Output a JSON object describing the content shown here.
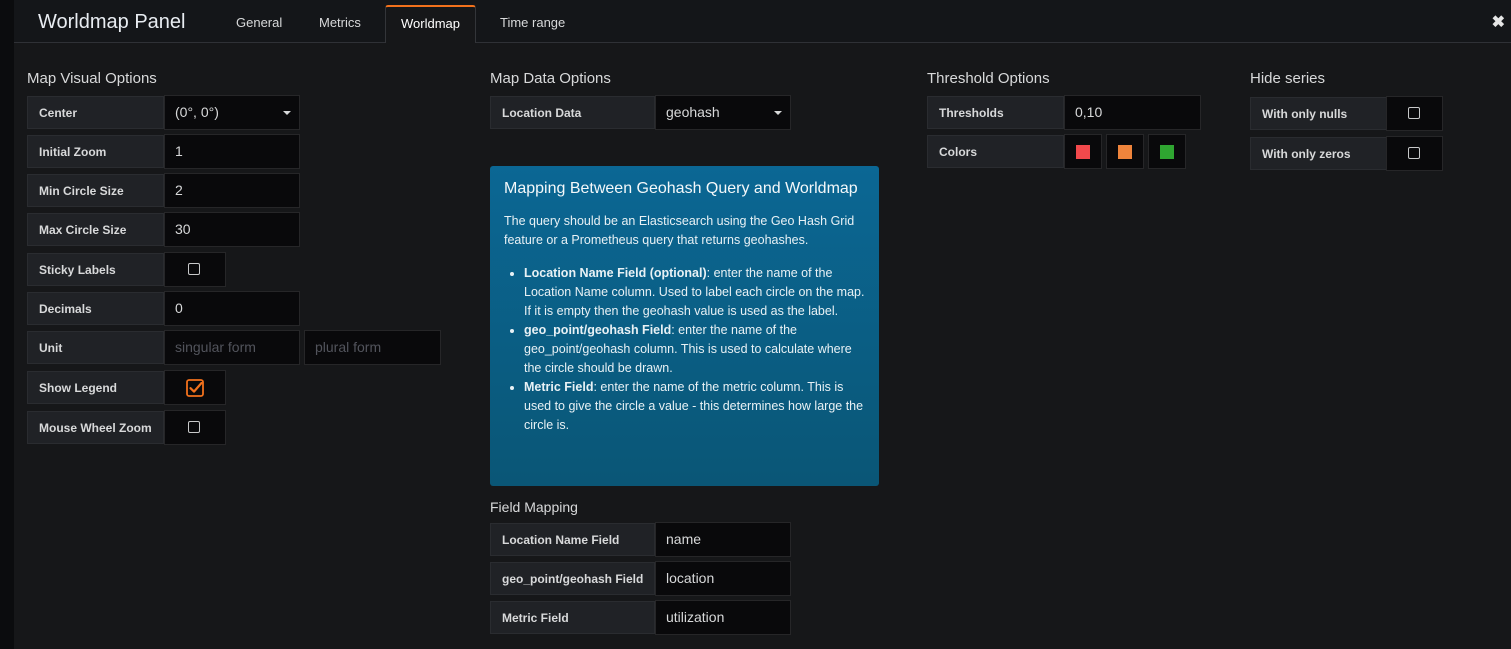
{
  "header": {
    "title": "Worldmap Panel",
    "tabs": [
      {
        "label": "General"
      },
      {
        "label": "Metrics"
      },
      {
        "label": "Worldmap"
      },
      {
        "label": "Time range"
      }
    ],
    "active_tab": "Worldmap",
    "close_symbol": "✖"
  },
  "map_visual": {
    "title": "Map Visual Options",
    "center": {
      "label": "Center",
      "value": "(0°, 0°)"
    },
    "initial_zoom": {
      "label": "Initial Zoom",
      "value": "1"
    },
    "min_circle": {
      "label": "Min Circle Size",
      "value": "2"
    },
    "max_circle": {
      "label": "Max Circle Size",
      "value": "30"
    },
    "sticky_labels": {
      "label": "Sticky Labels",
      "checked": false
    },
    "decimals": {
      "label": "Decimals",
      "value": "0"
    },
    "unit": {
      "label": "Unit",
      "singular_placeholder": "singular form",
      "plural_placeholder": "plural form"
    },
    "show_legend": {
      "label": "Show Legend",
      "checked": true
    },
    "mouse_wheel_zoom": {
      "label": "Mouse Wheel Zoom",
      "checked": false
    }
  },
  "map_data": {
    "title": "Map Data Options",
    "location_data": {
      "label": "Location Data",
      "value": "geohash"
    }
  },
  "info": {
    "title": "Mapping Between Geohash Query and Worldmap",
    "intro": "The query should be an Elasticsearch using the Geo Hash Grid feature or a Prometheus query that returns geohashes.",
    "items": [
      {
        "term": "Location Name Field (optional)",
        "text": ": enter the name of the Location Name column. Used to label each circle on the map. If it is empty then the geohash value is used as the label."
      },
      {
        "term": "geo_point/geohash Field",
        "text": ": enter the name of the geo_point/geohash column. This is used to calculate where the circle should be drawn."
      },
      {
        "term": "Metric Field",
        "text": ": enter the name of the metric column. This is used to give the circle a value - this determines how large the circle is."
      }
    ]
  },
  "field_mapping": {
    "title": "Field Mapping",
    "location_name": {
      "label": "Location Name Field",
      "value": "name"
    },
    "geo_point": {
      "label": "geo_point/geohash Field",
      "value": "location"
    },
    "metric": {
      "label": "Metric Field",
      "value": "utilization"
    }
  },
  "threshold": {
    "title": "Threshold Options",
    "thresholds": {
      "label": "Thresholds",
      "value": "0,10"
    },
    "colors": {
      "label": "Colors",
      "swatches": [
        "#f2494c",
        "#ef843c",
        "#2fa531"
      ]
    }
  },
  "hide_series": {
    "title": "Hide series",
    "with_only_nulls": {
      "label": "With only nulls",
      "checked": false
    },
    "with_only_zeros": {
      "label": "With only zeros",
      "checked": false
    }
  },
  "colors": {
    "accent": "#f2711c",
    "info_bg": "#0a5c80",
    "background": "#161719"
  }
}
